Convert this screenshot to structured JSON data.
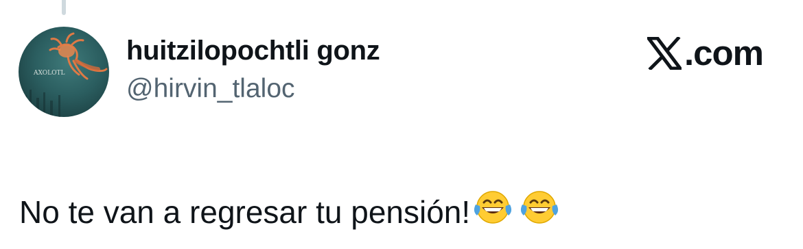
{
  "tweet": {
    "author": {
      "display_name": "huitzilopochtli gonz",
      "handle": "@hirvin_tlaloc",
      "avatar_icon": "axolotl-avatar",
      "avatar_text": "AXOLOTL"
    },
    "brand": {
      "icon": "x-logo-icon",
      "suffix": ".com"
    },
    "text": "No te van a regresar tu pensión!",
    "emojis": [
      "face-with-tears-of-joy-icon",
      "face-with-tears-of-joy-icon"
    ]
  },
  "colors": {
    "text_primary": "#0f1419",
    "text_secondary": "#536471",
    "thread_line": "#cfd9de",
    "emoji_yellow": "#ffcc33",
    "emoji_tears": "#4fa3e0"
  }
}
